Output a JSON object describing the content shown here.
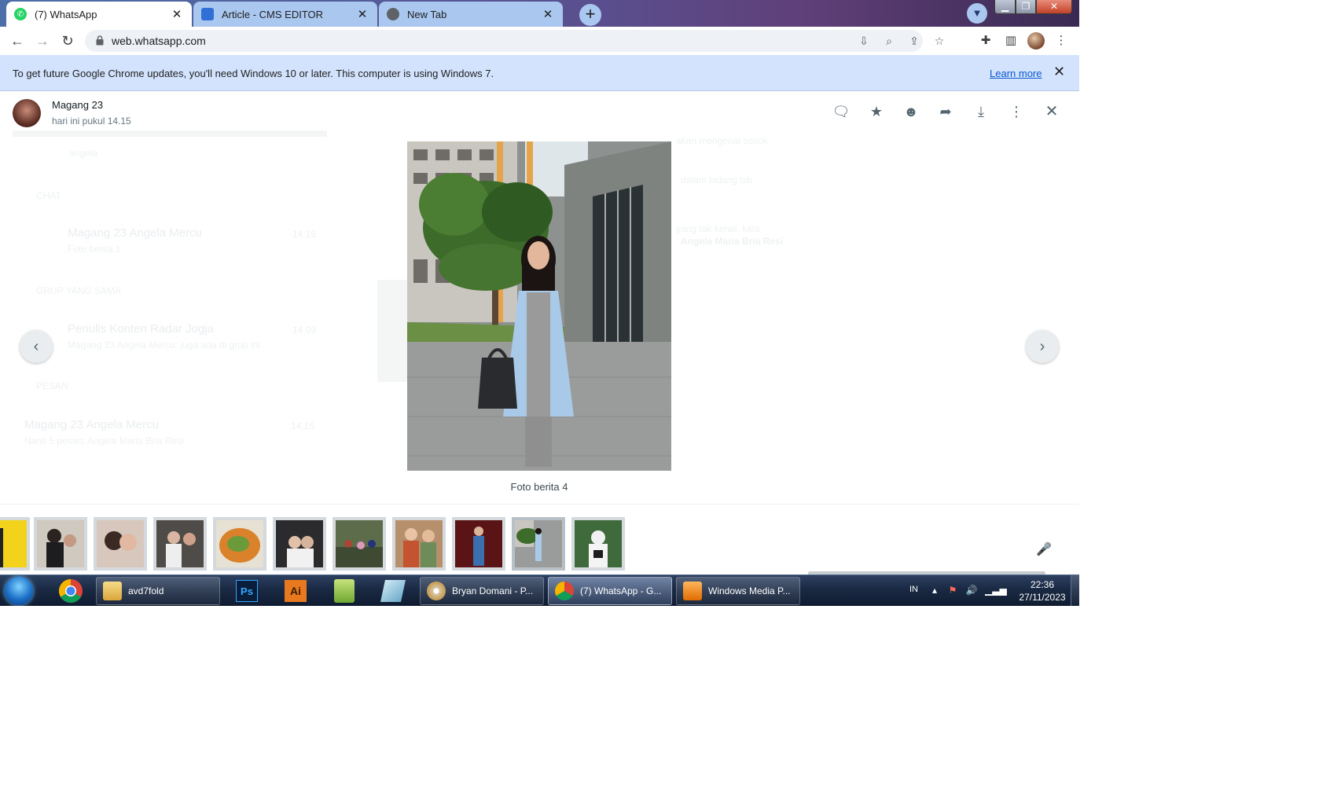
{
  "tabs": [
    {
      "title": "(7) WhatsApp",
      "active": true
    },
    {
      "title": "Article - CMS EDITOR",
      "active": false
    },
    {
      "title": "New Tab",
      "active": false
    }
  ],
  "tab_close_glyph": "✕",
  "omnibox": {
    "url": "web.whatsapp.com"
  },
  "infobar": {
    "message": "To get future Google Chrome updates, you'll need Windows 10 or later. This computer is using Windows 7.",
    "link": "Learn more"
  },
  "viewer": {
    "sender_name": "Magang 23",
    "sent_time": "hari ini pukul 14.15",
    "caption": "Foto berita 4"
  },
  "background_ghost": {
    "search_text": "angela",
    "section_chat": "CHAT",
    "chat_name": "Magang 23 Angela Mercu",
    "chat_time": "14.15",
    "chat_preview": "Foto berita 1",
    "section_groups": "GRUP YANG SAMA",
    "group_name": "Penulis Konten Radar Jogja",
    "group_time": "14.09",
    "group_preview": "Magang 23 Angela Mercu: juga ada di grup ini",
    "section_messages": "PESAN",
    "msg_name": "Magang 23 Angela Mercu",
    "msg_time": "14.15",
    "msg_preview": "Nanti 5 pesan: Angela Maria Bria Resi",
    "bubble_line1": "akan mengenal sosok",
    "bubble_line2": "dalam bidang tsb",
    "bubble_line3": "yang tak kenal, kata",
    "bubble_name": "Angela Maria Bria Resi"
  },
  "taskbar": {
    "tasks": [
      {
        "label": "avd7fold"
      },
      {
        "label": "Bryan Domani - P..."
      },
      {
        "label": "(7) WhatsApp - G..."
      },
      {
        "label": "Windows Media P..."
      }
    ],
    "ps_label": "Ps",
    "ai_label": "Ai",
    "tray_lang": "IN",
    "clock_time": "22:36",
    "clock_date": "27/11/2023"
  },
  "colors": {
    "infobar_bg": "#d3e3fd",
    "link": "#0b57d0",
    "whatsapp_green": "#25d366",
    "taskbar_bg": "#1a2a44"
  },
  "icons": {
    "header": [
      "message-icon",
      "star-icon",
      "emoji-icon",
      "forward-icon",
      "download-icon",
      "menu-icon",
      "close-icon"
    ],
    "nav": [
      "back-icon",
      "forward-nav-icon",
      "reload-icon"
    ]
  }
}
